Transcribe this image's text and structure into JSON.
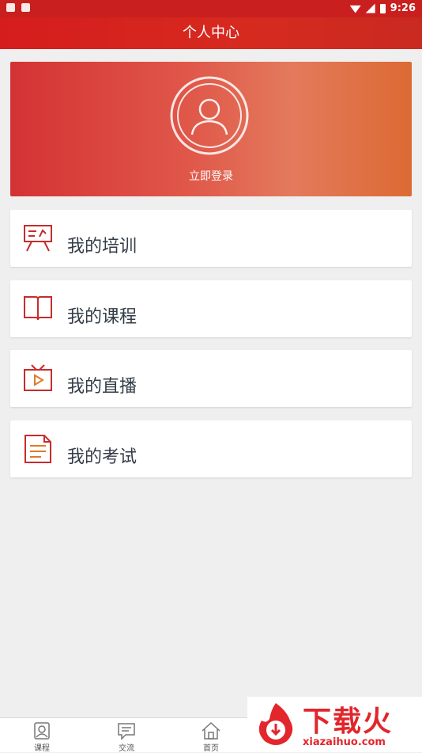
{
  "status_bar": {
    "time": "9:26"
  },
  "header": {
    "title": "个人中心"
  },
  "profile": {
    "login_label": "立即登录"
  },
  "menu": [
    {
      "label": "我的培训",
      "icon": "training-board-icon"
    },
    {
      "label": "我的课程",
      "icon": "book-icon"
    },
    {
      "label": "我的直播",
      "icon": "tv-live-icon"
    },
    {
      "label": "我的考试",
      "icon": "exam-document-icon"
    }
  ],
  "tabs": [
    {
      "label": "课程",
      "icon": "course-icon"
    },
    {
      "label": "交流",
      "icon": "chat-icon"
    },
    {
      "label": "首页",
      "icon": "home-icon"
    }
  ],
  "watermark": {
    "title": "下载火",
    "url": "xiazaihuo.com"
  },
  "colors": {
    "primary": "#d51d1d",
    "icon_red": "#c62c2c",
    "text": "#333c47"
  }
}
